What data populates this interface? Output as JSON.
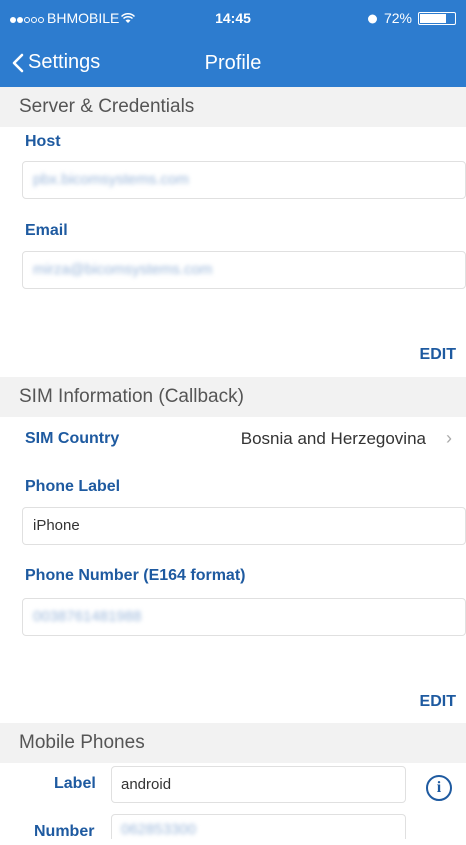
{
  "status_bar": {
    "carrier": "BHMOBILE",
    "time": "14:45",
    "battery_label": "72%",
    "battery_level": 0.72
  },
  "nav": {
    "back_label": "Settings",
    "title": "Profile"
  },
  "server": {
    "heading": "Server & Credentials",
    "host_label": "Host",
    "host_value": "pbx.bicomsystems.com",
    "email_label": "Email",
    "email_value": "mirza@bicomsystems.com",
    "edit_label": "EDIT"
  },
  "sim": {
    "heading": "SIM Information (Callback)",
    "country_label": "SIM Country",
    "country_value": "Bosnia and Herzegovina",
    "phone_label_label": "Phone Label",
    "phone_label_value": "iPhone",
    "phone_number_label": "Phone Number (E164 format)",
    "phone_number_value": "0038761481988",
    "edit_label": "EDIT"
  },
  "mobile": {
    "heading": "Mobile Phones",
    "label_label": "Label",
    "label_value": "android",
    "number_label": "Number",
    "number_value": "062853300"
  }
}
